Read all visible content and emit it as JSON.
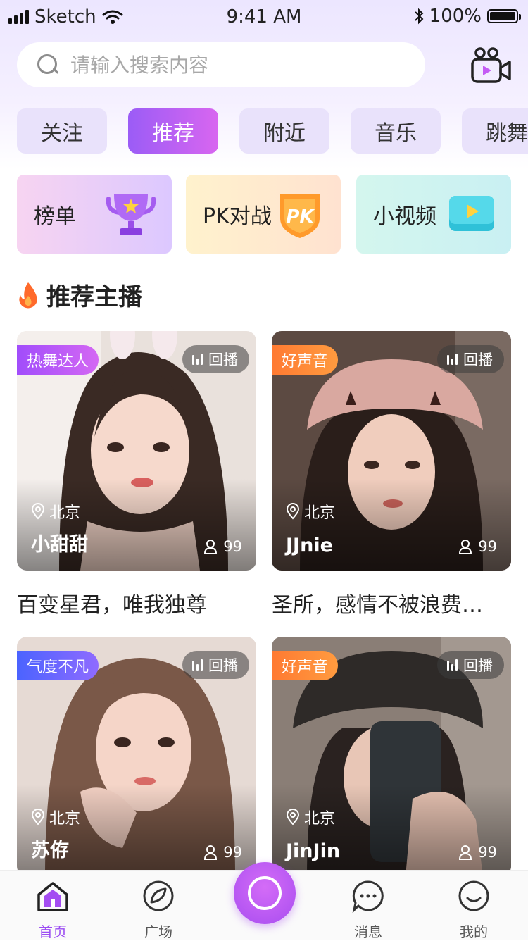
{
  "status_bar": {
    "carrier": "Sketch",
    "time": "9:41 AM",
    "battery": "100%"
  },
  "search": {
    "placeholder": "请输入搜索内容"
  },
  "tabs": [
    {
      "label": "关注",
      "active": false
    },
    {
      "label": "推荐",
      "active": true
    },
    {
      "label": "附近",
      "active": false
    },
    {
      "label": "音乐",
      "active": false
    },
    {
      "label": "跳舞",
      "active": false
    }
  ],
  "features": [
    {
      "label": "榜单",
      "icon": "trophy-icon"
    },
    {
      "label": "PK对战",
      "icon": "pk-shield-icon"
    },
    {
      "label": "小视频",
      "icon": "video-play-icon"
    }
  ],
  "section": {
    "title": "推荐主播",
    "icon": "flame-icon"
  },
  "streamers": [
    {
      "tag": "热舞达人",
      "replay": "回播",
      "location": "北京",
      "name": "小甜甜",
      "viewers": "99",
      "caption": "百变星君，唯我独尊"
    },
    {
      "tag": "好声音",
      "replay": "回播",
      "location": "北京",
      "name": "JJnie",
      "viewers": "99",
      "caption": "圣所，感情不被浪费…"
    },
    {
      "tag": "气度不凡",
      "replay": "回播",
      "location": "北京",
      "name": "苏侟",
      "viewers": "99",
      "caption": ""
    },
    {
      "tag": "好声音",
      "replay": "回播",
      "location": "北京",
      "name": "JinJin",
      "viewers": "99",
      "caption": ""
    }
  ],
  "bottom_nav": [
    {
      "label": "首页",
      "icon": "home-icon",
      "active": true
    },
    {
      "label": "广场",
      "icon": "compass-icon",
      "active": false
    },
    {
      "label": "消息",
      "icon": "message-icon",
      "active": false
    },
    {
      "label": "我的",
      "icon": "profile-icon",
      "active": false
    }
  ],
  "colors": {
    "accent": "#9b4cf3",
    "tag_purple": "#a14dfb",
    "tag_orange": "#ff7a32",
    "tag_blue": "#4b63ff"
  }
}
